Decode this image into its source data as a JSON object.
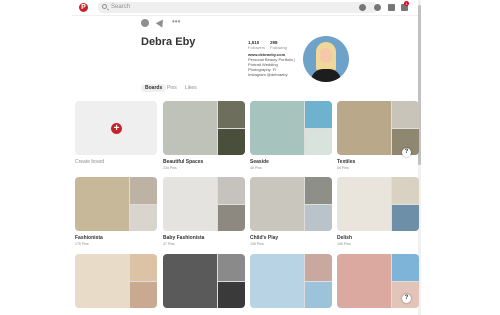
{
  "header": {
    "logo_text": "P",
    "search_placeholder": "Search",
    "notification_count": "1",
    "icons": [
      "pinterest-logo-icon",
      "search-icon",
      "compass-icon",
      "profile-icon",
      "messages-icon",
      "notifications-icon"
    ]
  },
  "profile": {
    "name": "Debra Eby",
    "followers_count": "1,510",
    "followers_label": "Followers",
    "following_count": "298",
    "following_label": "Following",
    "website": "www.debraeby.com",
    "bio": "Personal Beauty Portfolio | Portrait Wedding Photography. Fl",
    "location": "Instagram @debraeby",
    "profile_tool_icons": [
      "settings-gear-icon",
      "send-icon",
      "more-options-icon"
    ]
  },
  "tabs": [
    {
      "label": "Boards",
      "active": true
    },
    {
      "label": "Pins",
      "active": false
    },
    {
      "label": "Likes",
      "active": false
    }
  ],
  "create_board_label": "Create board",
  "help_label": "?",
  "boards": [
    {
      "title": "Beautiful Spaces",
      "meta": "234 Pins",
      "colors": [
        "#bfc2b8",
        "#6d6f5c",
        "#4a4f3c"
      ]
    },
    {
      "title": "Seaside",
      "meta": "46 Pins",
      "colors": [
        "#a6c4bd",
        "#6fb2cf",
        "#d9e3de"
      ]
    },
    {
      "title": "Textiles",
      "meta": "54 Pins",
      "colors": [
        "#b9a98a",
        "#c9c4b9",
        "#8f8770"
      ]
    },
    {
      "title": "Fashionista",
      "meta": "175 Pins",
      "colors": [
        "#c7b89a",
        "#bdb2a4",
        "#d9d4cd"
      ]
    },
    {
      "title": "Baby Fashionista",
      "meta": "47 Pins",
      "colors": [
        "#e5e3e0",
        "#c6c2bd",
        "#8e8980"
      ]
    },
    {
      "title": "Child's Play",
      "meta": "106 Pins",
      "colors": [
        "#c9c6bd",
        "#8f8f8a",
        "#b9c3c9"
      ]
    },
    {
      "title": "Delish",
      "meta": "165 Pins",
      "colors": [
        "#e9e5dd",
        "#d9d2c3",
        "#6d8fa8"
      ]
    },
    {
      "title": "",
      "meta": "",
      "colors": [
        "#e8dcc9",
        "#dcc3a6",
        "#c9a98f"
      ]
    },
    {
      "title": "",
      "meta": "",
      "colors": [
        "#5a5a5a",
        "#8a8a8a",
        "#3a3a3a"
      ]
    },
    {
      "title": "",
      "meta": "",
      "colors": [
        "#b7d3e4",
        "#c9a8a0",
        "#9cc3d9"
      ]
    },
    {
      "title": "",
      "meta": "",
      "colors": [
        "#dba9a0",
        "#7fb4d9",
        "#e3c4b9"
      ]
    }
  ]
}
